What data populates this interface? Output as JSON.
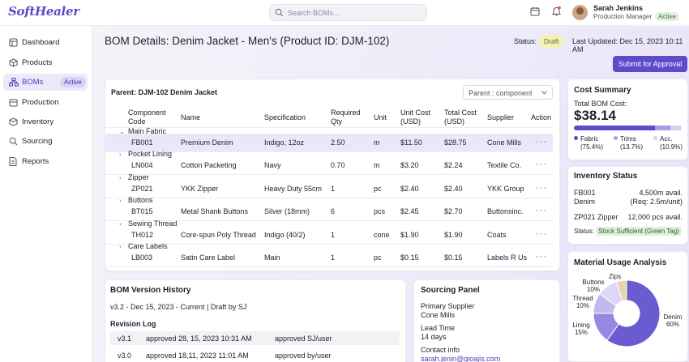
{
  "app": {
    "logo": "SoftHealer"
  },
  "search": {
    "placeholder": "Search BOMs..."
  },
  "user": {
    "name": "Sarah Jenkins",
    "role": "Production Manager",
    "status": "Active"
  },
  "sidebar": {
    "items": [
      {
        "label": "Dashboard",
        "icon": "grid-icon"
      },
      {
        "label": "Products",
        "icon": "box-icon"
      },
      {
        "label": "BOMs",
        "icon": "hierarchy-icon",
        "badge": "Active"
      },
      {
        "label": "Production",
        "icon": "factory-icon"
      },
      {
        "label": "Inventory",
        "icon": "cube-icon"
      },
      {
        "label": "Sourcing",
        "icon": "search-icon"
      },
      {
        "label": "Reports",
        "icon": "document-icon"
      }
    ]
  },
  "header": {
    "title": "BOM Details: Denim Jacket - Men's (Product ID: DJM-102)",
    "status_label": "Status:",
    "status": "Draft",
    "updated": "Last Updated: Dec 15, 2023 10:11 AM",
    "submit": "Submit for Approval"
  },
  "bom": {
    "parent": "Parent: DJM-102 Denim Jacket",
    "select": "Parent : component",
    "columns": {
      "code": "Component Code",
      "name": "Name",
      "spec": "Specification",
      "qty": "Required Qty",
      "unit": "Unit",
      "ucost": "Unit Cost (USD)",
      "tcost": "Total Cost (USD)",
      "supplier": "Supplier",
      "action": "Action"
    },
    "groups": [
      {
        "label": "Main Fabric",
        "code": "FB001",
        "name": "Premium Denim",
        "spec": "Indigo, 12oz",
        "qty": "2.50",
        "unit": "m",
        "ucost": "$11.50",
        "tcost": "$28.75",
        "supplier": "Cone Mills"
      },
      {
        "label": "Pocket Lining",
        "code": "LN004",
        "name": "Cotton Packeting",
        "spec": "Navy",
        "qty": "0.70",
        "unit": "m",
        "ucost": "$3.20",
        "tcost": "$2.24",
        "supplier": "Textile Co."
      },
      {
        "label": "Zipper",
        "code": "ZP021",
        "name": "YKK Zipper",
        "spec": "Heavy Duty 55cm",
        "qty": "1",
        "unit": "pc",
        "ucost": "$2.40",
        "tcost": "$2.40",
        "supplier": "YKK Group"
      },
      {
        "label": "Buttons",
        "code": "BT015",
        "name": "Metal Shank Buttons",
        "spec": "Silver (18mm)",
        "qty": "6",
        "unit": "pcs",
        "ucost": "$2.45",
        "tcost": "$2.70",
        "supplier": "Buttonsinc."
      },
      {
        "label": "Sewing Thread",
        "code": "TH012",
        "name": "Core-spun Poly Thread",
        "spec": "Indigo (40/2)",
        "qty": "1",
        "unit": "cone",
        "ucost": "$1.90",
        "tcost": "$1.90",
        "supplier": "Coats"
      },
      {
        "label": "Care Labels",
        "code": "LB003",
        "name": "Satin Care Label",
        "spec": "Main",
        "qty": "1",
        "unit": "pc",
        "ucost": "$0.15",
        "tcost": "$0.15",
        "supplier": "Labels R Us"
      }
    ]
  },
  "cost": {
    "title": "Cost Summary",
    "total_label": "Total BOM Cost:",
    "total": "$38.14",
    "segments": [
      {
        "name": "Fabric",
        "pct": "(75.4%)",
        "value": 75.4,
        "color": "#5b4ccc"
      },
      {
        "name": "Trims",
        "pct": "(13.7%)",
        "value": 13.7,
        "color": "#a79de6"
      },
      {
        "name": "Acc.",
        "pct": "(10.9%)",
        "value": 10.9,
        "color": "#d5d0f3"
      }
    ]
  },
  "inventory": {
    "title": "Inventory Status",
    "r1_name": "FB001 Denim",
    "r1_val": "4,500m avail.",
    "r1_req": "(Req: 2.5m/unit)",
    "r2_name": "ZP021 Zipper",
    "r2_val": "12,000 pcs avail.",
    "status_label": "Status:",
    "status_tag": "Stock Sufficient (Green Tag)"
  },
  "usage": {
    "title": "Material Usage Analysis",
    "slices": [
      {
        "name": "Denim",
        "value": 60,
        "pct": "60%",
        "color": "#6a5bd0"
      },
      {
        "name": "Lining",
        "value": 15,
        "pct": "15%",
        "color": "#9588e2"
      },
      {
        "name": "Thread",
        "value": 10,
        "pct": "10%",
        "color": "#c2b9ef"
      },
      {
        "name": "Buttons",
        "value": 10,
        "pct": "10%",
        "color": "#ddd6f6"
      },
      {
        "name": "Zips",
        "value": 5,
        "pct": "",
        "color": "#e3d5b0"
      }
    ]
  },
  "version": {
    "title": "BOM Version History",
    "current": "v3.2 - Dec 15, 2023 - Current | Draft by SJ",
    "log_title": "Revision Log",
    "log": [
      {
        "ver": "v3.1",
        "desc": "approved 28, 15, 2023 10:31 AM",
        "by": "approved SJ/user"
      },
      {
        "ver": "v3.0",
        "desc": "approved 18,11, 2023 11:01 AM",
        "by": "approved by/user"
      }
    ]
  },
  "sourcing": {
    "title": "Sourcing Panel",
    "supplier_label": "Primary Supplier",
    "supplier": "Cone Mills",
    "lead_label": "Lead Time",
    "lead": "14 days",
    "contact_label": "Contact info",
    "email": "sarah.jenin@gioajis.com"
  }
}
